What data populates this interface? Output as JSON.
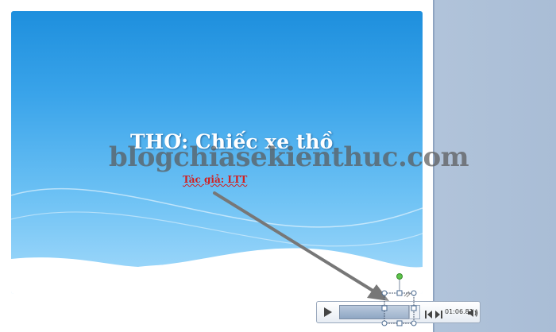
{
  "slide": {
    "title": "THƠ: Chiếc xe thồ",
    "author": "Tác giả: LTT"
  },
  "watermark": "blogchiasekienthuc.com",
  "media_player": {
    "time": "01:06.81",
    "icons": [
      "play-icon",
      "previous-frame-icon",
      "next-frame-icon",
      "volume-icon"
    ]
  },
  "colors": {
    "slide_top": "#1e8fdd",
    "slide_bottom": "#a8dcfb",
    "author_text": "#d21f1f",
    "arrow": "#777777",
    "rotation_handle": "#5cc44a"
  }
}
